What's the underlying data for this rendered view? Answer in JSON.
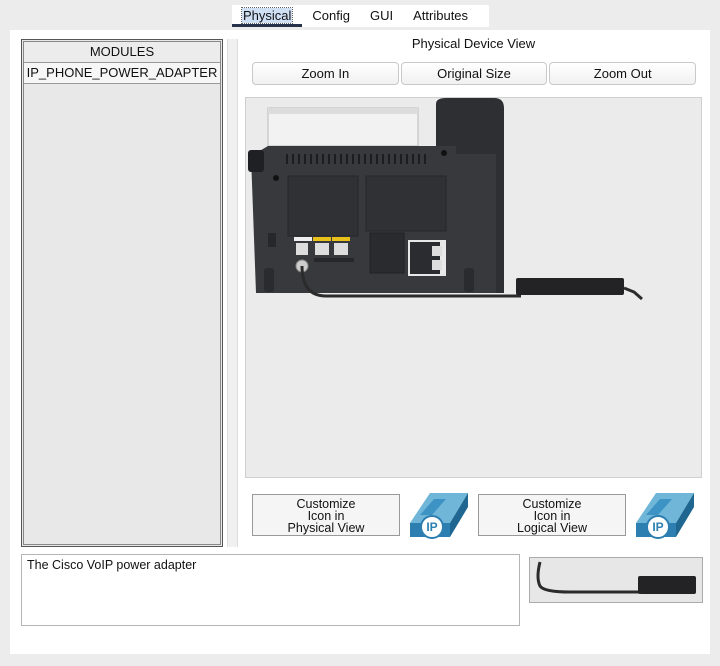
{
  "tabs": [
    {
      "label": "Physical",
      "active": true
    },
    {
      "label": "Config"
    },
    {
      "label": "GUI"
    },
    {
      "label": "Attributes"
    }
  ],
  "modules": {
    "header": "MODULES",
    "items": [
      "IP_PHONE_POWER_ADAPTER"
    ]
  },
  "view": {
    "title": "Physical Device View",
    "zoom_in": "Zoom In",
    "original_size": "Original Size",
    "zoom_out": "Zoom Out"
  },
  "customize": {
    "physical": [
      "Customize",
      "Icon in",
      "Physical View"
    ],
    "logical": [
      "Customize",
      "Icon in",
      "Logical View"
    ]
  },
  "icon_label": "IP",
  "description": "The Cisco VoIP power adapter",
  "icons": {
    "physical_view_icon": "ip-phone-icon",
    "logical_view_icon": "ip-phone-icon",
    "thumbnail": "power-adapter-image"
  }
}
